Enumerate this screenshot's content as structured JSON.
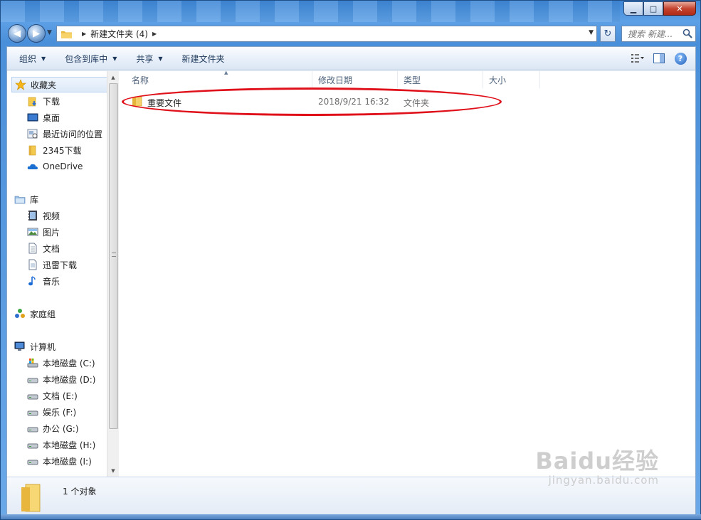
{
  "window": {
    "caption_min": "▁",
    "caption_max": "□",
    "caption_close": "✕"
  },
  "address": {
    "path": "新建文件夹 (4)",
    "search_placeholder": "搜索 新建...",
    "refresh": "↻"
  },
  "toolbar": {
    "organize": "组织",
    "include_in_library": "包含到库中",
    "share": "共享",
    "new_folder": "新建文件夹",
    "help": "?"
  },
  "nav": {
    "favorites": "收藏夹",
    "fav_items": [
      "下载",
      "桌面",
      "最近访问的位置",
      "2345下载",
      "OneDrive"
    ],
    "libraries": "库",
    "lib_items": [
      "视频",
      "图片",
      "文档",
      "迅雷下载",
      "音乐"
    ],
    "homegroup": "家庭组",
    "computer": "计算机",
    "drives": [
      "本地磁盘 (C:)",
      "本地磁盘 (D:)",
      "文档 (E:)",
      "娱乐 (F:)",
      "办公 (G:)",
      "本地磁盘 (H:)",
      "本地磁盘 (I:)"
    ]
  },
  "columns": {
    "name": "名称",
    "date": "修改日期",
    "type": "类型",
    "size": "大小"
  },
  "files": [
    {
      "name": "重要文件",
      "date": "2018/9/21 16:32",
      "type": "文件夹",
      "size": ""
    }
  ],
  "status": {
    "count": "1 个对象"
  },
  "watermark": {
    "brand": "Baidu经验",
    "url": "jingyan.baidu.com"
  },
  "colors": {
    "highlight_ellipse": "#e0101a",
    "folder_yellow": "#f2c94c"
  }
}
